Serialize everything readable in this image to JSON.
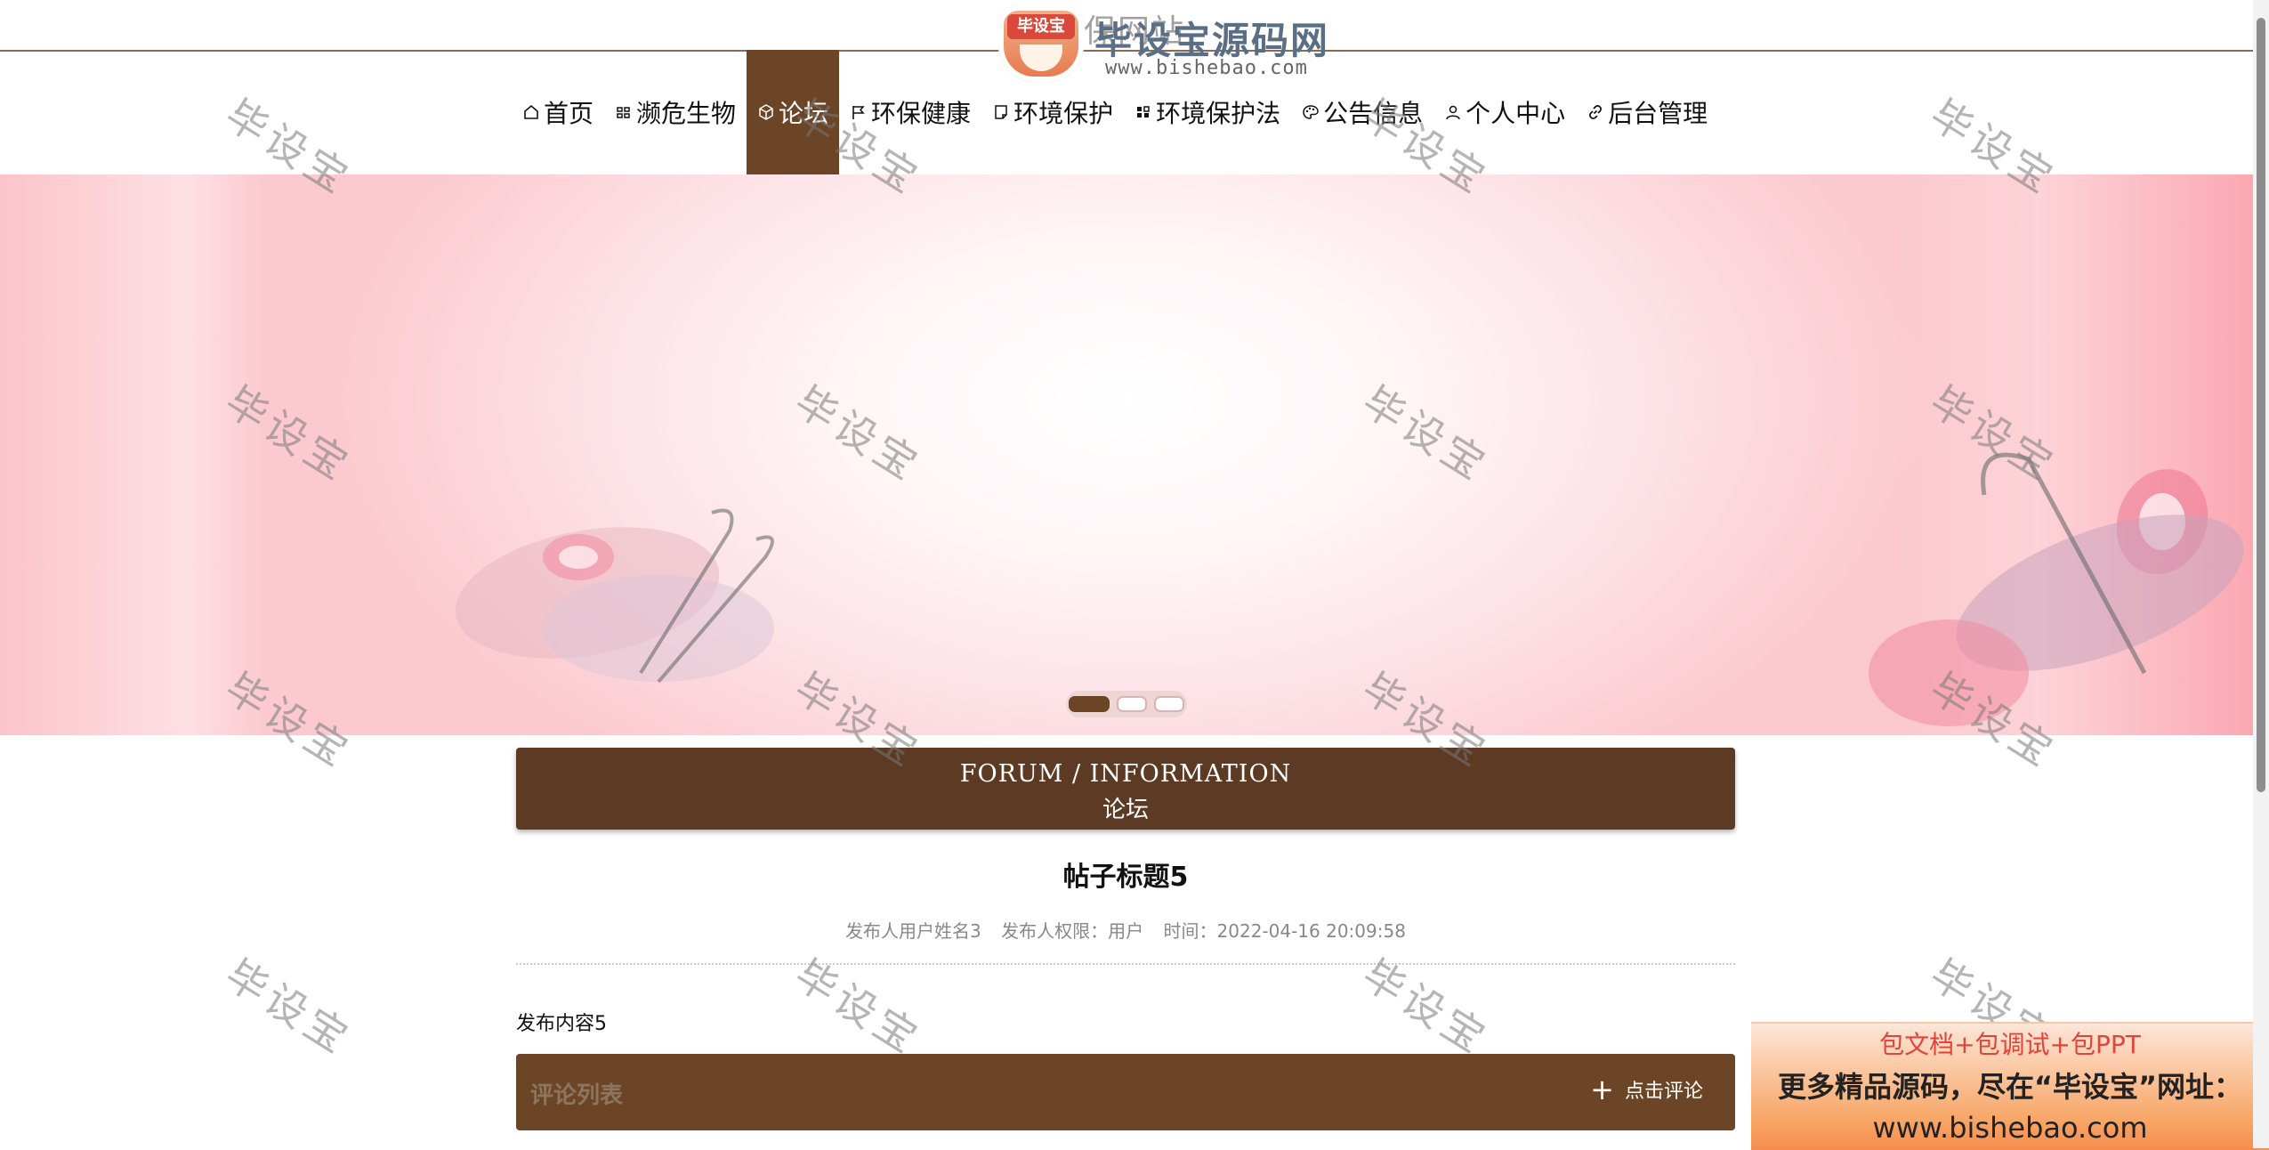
{
  "header": {
    "site_title": "环保网站",
    "logo": {
      "name": "毕设宝源码网",
      "url": "www.bishebao.com",
      "badge": "毕设宝"
    }
  },
  "nav": {
    "items": [
      {
        "label": "首页",
        "icon": "home-icon",
        "active": false
      },
      {
        "label": "濒危生物",
        "icon": "grid-icon",
        "active": false
      },
      {
        "label": "论坛",
        "icon": "cube-icon",
        "active": true
      },
      {
        "label": "环保健康",
        "icon": "flag-icon",
        "active": false
      },
      {
        "label": "环境保护",
        "icon": "note-icon",
        "active": false
      },
      {
        "label": "环境保护法",
        "icon": "apps-icon",
        "active": false
      },
      {
        "label": "公告信息",
        "icon": "palette-icon",
        "active": false
      },
      {
        "label": "个人中心",
        "icon": "user-icon",
        "active": false
      },
      {
        "label": "后台管理",
        "icon": "link-icon",
        "active": false
      }
    ]
  },
  "carousel": {
    "slide_count": 3,
    "active_index": 0
  },
  "section": {
    "title_en": "FORUM / INFORMATION",
    "title_cn": "论坛"
  },
  "post": {
    "title": "帖子标题5",
    "author": "发布人用户姓名3",
    "role": "发布人权限：用户",
    "time": "时间：2022-04-16 20:09:58",
    "content": "发布内容5"
  },
  "comments": {
    "label": "评论列表",
    "button": "点击评论"
  },
  "watermark": "毕设宝",
  "promo": {
    "line1": "包文档+包调试+包PPT",
    "line2": "更多精品源码，尽在“毕设宝”网址：",
    "line3": "www.bishebao.com"
  },
  "colors": {
    "accent": "#6b4526",
    "section_bg": "#5c3a23",
    "promo_red": "#e0443a"
  }
}
